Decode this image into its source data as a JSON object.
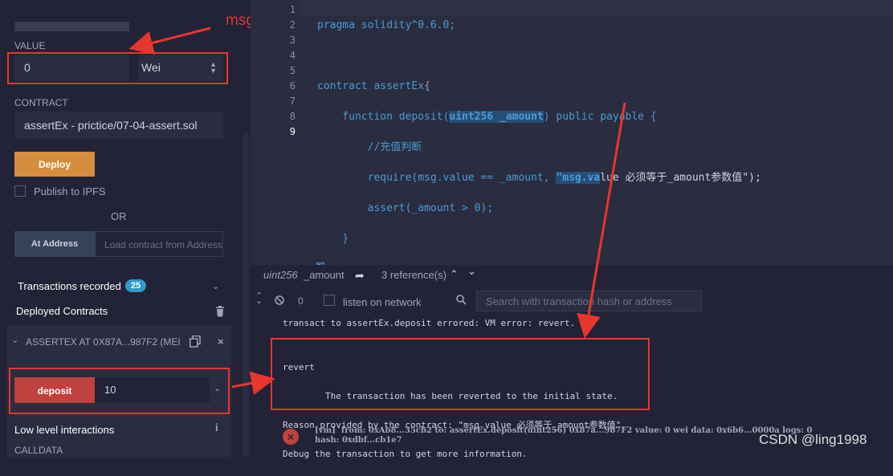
{
  "left": {
    "value_label": "VALUE",
    "value_input": "0",
    "unit_select": "Wei",
    "contract_label": "CONTRACT",
    "contract_select": "assertEx - prictice/07-04-assert.sol",
    "deploy_label": "Deploy",
    "publish_label": "Publish to IPFS",
    "or_label": "OR",
    "at_address_label": "At Address",
    "load_placeholder": "Load contract from Address",
    "transactions_label": "Transactions recorded",
    "transactions_count": "25",
    "deployed_label": "Deployed Contracts",
    "instance_label": "ASSERTEX AT 0X87A...987F2 (MEI",
    "deposit_label": "deposit",
    "deposit_input": "10",
    "low_level_label": "Low level interactions",
    "calldata_label": "CALLDATA"
  },
  "annotations": {
    "msg_value": "msg.value"
  },
  "editor": {
    "line_numbers": [
      "1",
      "2",
      "3",
      "4",
      "5",
      "6",
      "7",
      "8",
      "9"
    ],
    "lines": {
      "l1": "pragma solidity^0.6.0;",
      "l3a": "contract assertEx",
      "l3b": "{",
      "l4a": "    function deposit(",
      "l4b": "uint256 _amount",
      "l4c": ") public payable {",
      "l5": "        //充值判断",
      "l6a": "        require(msg.value == _amount, ",
      "l6b": "\"msg.va",
      "l6c": "lue 必须等于_amount参数值\");",
      "l7": "        assert(_amount > 0);",
      "l8": "    }",
      "l9": "}"
    }
  },
  "termbar": {
    "type": "uint256",
    "name": "_amount",
    "refs": "3 reference(s)"
  },
  "termtool": {
    "count": "0",
    "listen_label": "listen on network",
    "search_placeholder": "Search with transaction hash or address"
  },
  "terminal": {
    "line1": "transact to assertEx.deposit errored: VM error: revert.",
    "revert": "revert",
    "r1": "        The transaction has been reverted to the initial state.",
    "r2": "Reason provided by the contract: \"msg.value 必须等于_amount参数值\".",
    "r3": "Debug the transaction to get more information.",
    "vm_line": "[vm]  from: 0xAb8...35cb2 to: assertEx.deposit(uint256) 0x87a...987F2 value: 0 wei data: 0x6b6...0000a logs: 0",
    "hash_line": "hash: 0xdbf...cb1e7",
    "watermark": "CSDN @ling1998"
  },
  "colors": {
    "accent": "#2d9bcc",
    "deploy": "#d68e3d",
    "deposit": "#c0413d",
    "red_annotation": "#e8352e"
  }
}
